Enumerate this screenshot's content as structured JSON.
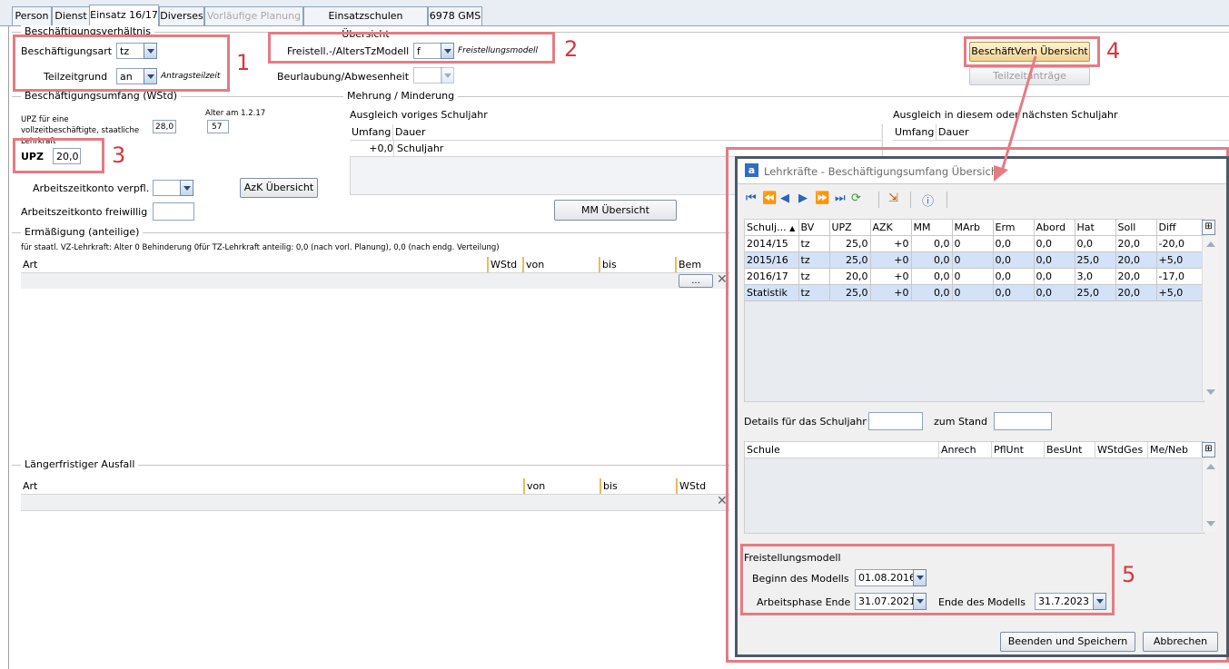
{
  "tabs": [
    {
      "label": "Person",
      "state": "normal"
    },
    {
      "label": "Dienst",
      "state": "normal"
    },
    {
      "label": "Einsatz 16/17",
      "state": "active"
    },
    {
      "label": "Diverses",
      "state": "normal"
    },
    {
      "label": "Vorläufige Planung",
      "state": "disabled"
    },
    {
      "label": "Einsatzschulen Übersicht",
      "state": "normal"
    },
    {
      "label": "6978 GMS",
      "state": "normal"
    }
  ],
  "beschaeftigung": {
    "group_title": "Beschäftigungsverhältnis",
    "art_label": "Beschäftigungsart",
    "art_value": "tz",
    "grund_label": "Teilzeitgrund",
    "grund_value": "an",
    "grund_note": "Antragsteilzeit",
    "freistell_label": "Freistell.-/AltersTzModell",
    "freistell_value": "f",
    "freistell_note": "Freistellungsmodell",
    "beurlaubung_label": "Beurlaubung/Abwesenheit",
    "beurlaubung_value": "",
    "overview_button": "BeschäftVerh Übersicht",
    "teilzeit_button": "Teilzeitanträge"
  },
  "umfang": {
    "group_title": "Beschäftigungsumfang (WStd)",
    "upz_vz_label": "UPZ für eine vollzeitbeschäftigte, staatliche Lehrkraft",
    "upz_vz_value": "28,0",
    "alter_label": "Alter am 1.2.17",
    "alter_value": "57",
    "upz_label": "UPZ",
    "upz_value": "20,0",
    "azk_verpfl_label": "Arbeitszeitkonto verpfl.",
    "azk_verpfl_value": "",
    "azk_frei_label": "Arbeitszeitkonto freiwillig",
    "azk_frei_value": "",
    "azk_button": "AzK Übersicht"
  },
  "mehrung": {
    "group_title": "Mehrung / Minderung",
    "prev_title": "Ausgleich voriges Schuljahr",
    "cur_title": "Ausgleich in diesem oder nächsten Schuljahr",
    "col_umfang": "Umfang",
    "col_dauer": "Dauer",
    "row_umfang": "+0,0",
    "row_dauer": "Schuljahr",
    "mm_button": "MM Übersicht"
  },
  "ermaessigung": {
    "group_title": "Ermäßigung (anteilige)",
    "info_vz": "für staatl. VZ-Lehrkraft: Alter 0 Behinderung 0",
    "info_tz": "für TZ-Lehrkraft anteilig: 0,0 (nach vorl. Planung), 0,0 (nach endg. Verteilung)",
    "cols": [
      "Art",
      "WStd",
      "von",
      "bis",
      "Bem"
    ],
    "row_button": "..."
  },
  "ausfall": {
    "group_title": "Längerfristiger Ausfall",
    "cols": [
      "Art",
      "von",
      "bis",
      "WStd"
    ]
  },
  "annotations": [
    "1",
    "2",
    "3",
    "4",
    "5"
  ],
  "dialog": {
    "title": "Lehrkräfte - Beschäftigungsumfang Übersicht",
    "toolbar_icons": [
      "first-icon",
      "prev-page-icon",
      "prev-icon",
      "next-icon",
      "next-page-icon",
      "last-icon",
      "refresh-icon",
      "export-icon",
      "help-icon"
    ],
    "grid": {
      "cols": [
        "Schulj...",
        "BV",
        "UPZ",
        "AZK",
        "MM",
        "MArb",
        "Erm",
        "Abord",
        "Hat",
        "Soll",
        "Diff"
      ],
      "rows": [
        {
          "selected": false,
          "cells": [
            "2014/15",
            "tz",
            "25,0",
            "+0",
            "0,0",
            "0",
            "0,0",
            "0,0",
            "0,0",
            "20,0",
            "-20,0"
          ]
        },
        {
          "selected": true,
          "cells": [
            "2015/16",
            "tz",
            "25,0",
            "+0",
            "0,0",
            "0",
            "0,0",
            "0,0",
            "25,0",
            "20,0",
            "+5,0"
          ]
        },
        {
          "selected": false,
          "cells": [
            "2016/17",
            "tz",
            "20,0",
            "+0",
            "0,0",
            "0",
            "0,0",
            "0,0",
            "3,0",
            "20,0",
            "-17,0"
          ]
        },
        {
          "selected": true,
          "cells": [
            "Statistik",
            "tz",
            "25,0",
            "+0",
            "0,0",
            "0",
            "0,0",
            "0,0",
            "25,0",
            "20,0",
            "+5,0"
          ]
        }
      ]
    },
    "details_label": "Details für das Schuljahr",
    "details_value": "",
    "stand_label": "zum Stand",
    "stand_value": "",
    "schule_cols": [
      "Schule",
      "Anrech",
      "PflUnt",
      "BesUnt",
      "WStdGes",
      "Me/Neb"
    ],
    "freistell": {
      "title": "Freistellungsmodell",
      "beginn_label": "Beginn des Modells",
      "beginn_value": "01.08.2016",
      "arbeit_label": "Arbeitsphase Ende",
      "arbeit_value": "31.07.2021",
      "ende_label": "Ende des Modells",
      "ende_value": "31.7.2023"
    },
    "save_button": "Beenden und Speichern",
    "cancel_button": "Abbrechen"
  },
  "colors": {
    "highlight": "#e57b83",
    "annotation": "#d9343f",
    "selection": "#d3e2f7",
    "header_separator": "#f0b955"
  }
}
